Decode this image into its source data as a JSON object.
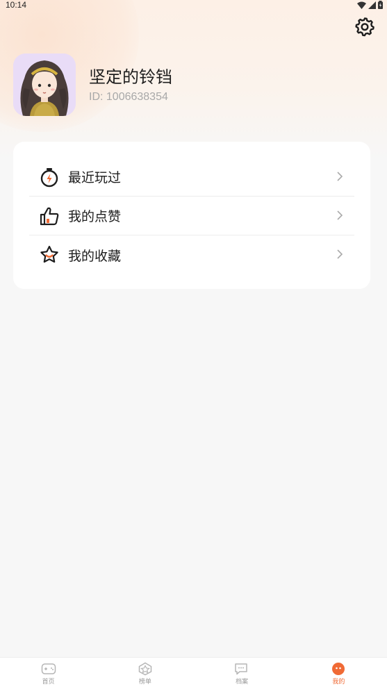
{
  "status_bar": {
    "time": "10:14"
  },
  "profile": {
    "username": "坚定的铃铛",
    "user_id": "ID: 1006638354",
    "avatar_icon": "girl-avatar-illustration"
  },
  "menu": {
    "items": [
      {
        "label": "最近玩过",
        "icon": "stopwatch-icon"
      },
      {
        "label": "我的点赞",
        "icon": "thumbs-up-icon"
      },
      {
        "label": "我的收藏",
        "icon": "star-icon"
      }
    ]
  },
  "tabbar": {
    "tabs": [
      {
        "label": "首页",
        "icon": "gamepad-icon",
        "active": false
      },
      {
        "label": "榜单",
        "icon": "trophy-icon",
        "active": false
      },
      {
        "label": "档案",
        "icon": "chat-icon",
        "active": false
      },
      {
        "label": "我的",
        "icon": "profile-icon",
        "active": true
      }
    ]
  },
  "colors": {
    "accent": "#f06a35",
    "avatar_bg": "#e9dcf7",
    "header_gradient": "#fdf0e6",
    "page_bg": "#f7f7f7"
  }
}
